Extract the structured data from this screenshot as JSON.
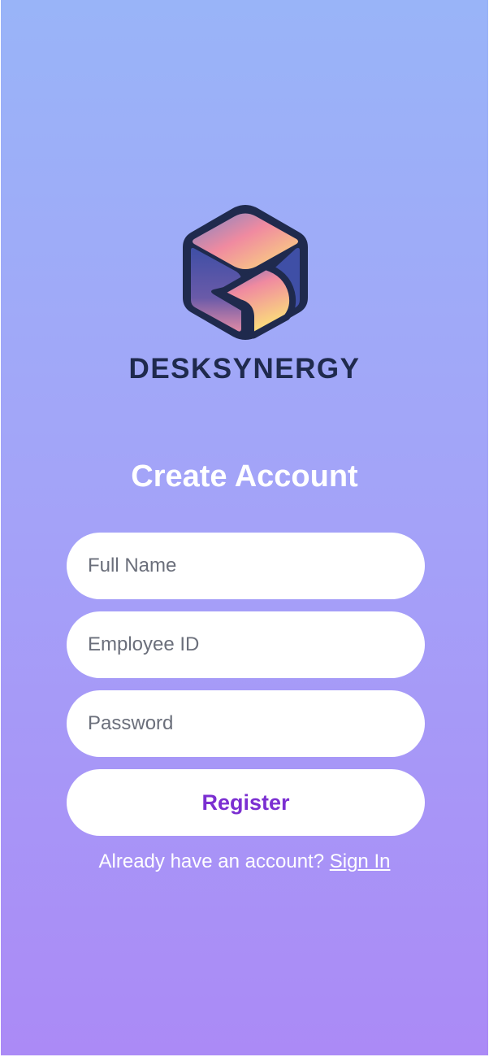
{
  "brand": {
    "name": "DESKSYNERGY",
    "logo_icon": "cube-logo-icon"
  },
  "form": {
    "title": "Create Account",
    "full_name_placeholder": "Full Name",
    "employee_id_placeholder": "Employee ID",
    "password_placeholder": "Password",
    "register_label": "Register"
  },
  "footer": {
    "prompt": "Already have an account? ",
    "sign_in_label": "Sign In"
  },
  "colors": {
    "background_top": "#99b4f8",
    "background_bottom": "#ab8af6",
    "brand_text": "#1f2a4d",
    "button_text": "#7b2fd1"
  }
}
